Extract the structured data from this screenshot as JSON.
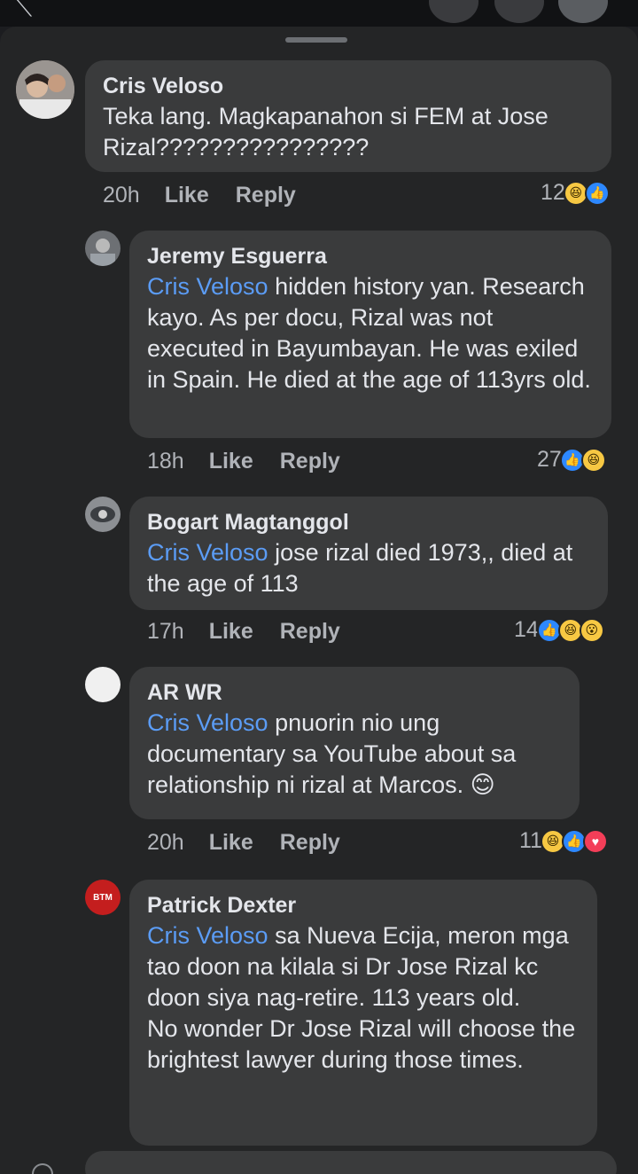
{
  "comments": [
    {
      "author": "Cris Veloso",
      "mention": "",
      "text": "Teka lang. Magkapanahon si FEM at Jose Rizal????????????????",
      "time": "20h",
      "like": "Like",
      "reply": "Reply",
      "reaction_count": "12",
      "reactions": [
        "haha-icon",
        "like-icon"
      ]
    },
    {
      "author": "Jeremy Esguerra",
      "mention": "Cris Veloso",
      "text": " hidden history yan. Research kayo. As per docu, Rizal was not executed in Bayumbayan. He was exiled in Spain. He died at the age of 113yrs old.",
      "time": "18h",
      "like": "Like",
      "reply": "Reply",
      "reaction_count": "27",
      "reactions": [
        "like-icon",
        "haha-icon"
      ]
    },
    {
      "author": "Bogart Magtanggol",
      "mention": "Cris Veloso",
      "text": " jose rizal died 1973,, died at the age of 113",
      "time": "17h",
      "like": "Like",
      "reply": "Reply",
      "reaction_count": "14",
      "reactions": [
        "like-icon",
        "haha-icon",
        "wow-icon"
      ]
    },
    {
      "author": "AR WR",
      "mention": "Cris Veloso",
      "text": " pnuorin nio ung documentary sa YouTube about sa relationship ni rizal at Marcos. 😊",
      "time": "20h",
      "like": "Like",
      "reply": "Reply",
      "reaction_count": "11",
      "reactions": [
        "haha-icon",
        "like-icon",
        "love-icon"
      ]
    },
    {
      "author": "Patrick Dexter",
      "mention": "Cris Veloso",
      "text": " sa Nueva Ecija, meron mga tao doon na kilala si Dr Jose Rizal kc doon siya nag-retire. 113 years old.\nNo wonder Dr Jose Rizal will choose the brightest lawyer during those times.",
      "time": "",
      "like": "",
      "reply": "",
      "reaction_count": "",
      "reactions": []
    }
  ],
  "avatar_badge_patrick": "BTM",
  "colors": {
    "background": "#242526",
    "bubble": "#3a3b3c",
    "mention": "#5b9cf5",
    "meta": "#b0b3b8"
  }
}
